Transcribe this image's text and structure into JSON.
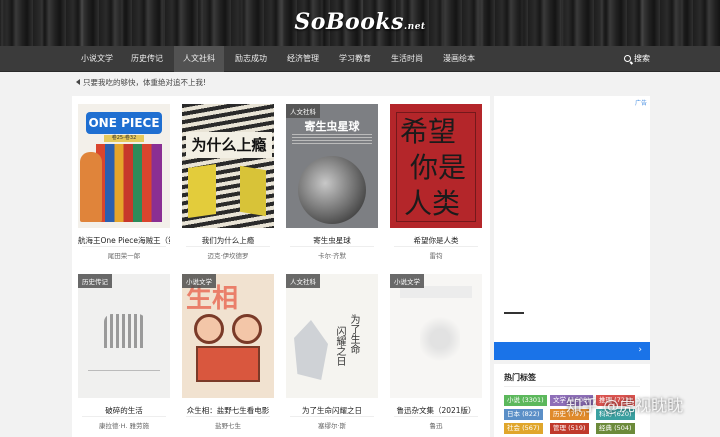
{
  "header": {
    "logo": "SoBooks",
    "logo_suffix": ".net"
  },
  "nav": {
    "items": [
      {
        "label": "小说文学",
        "active": false
      },
      {
        "label": "历史传记",
        "active": false
      },
      {
        "label": "人文社科",
        "active": true
      },
      {
        "label": "励志成功",
        "active": false
      },
      {
        "label": "经济管理",
        "active": false
      },
      {
        "label": "学习教育",
        "active": false
      },
      {
        "label": "生活时尚",
        "active": false
      },
      {
        "label": "漫画绘本",
        "active": false
      }
    ],
    "search_label": "搜索"
  },
  "notice": "只要我吃的够快，体重绝对追不上我!",
  "books": [
    {
      "title": "航海王One Piece海贼王（第",
      "author": "尾田荣一郎",
      "badge": "",
      "cover_text": "ONE PIECE",
      "cover_sub": "卷25-卷32"
    },
    {
      "title": "我们为什么上瘾",
      "author": "迈克·伊坎德罗",
      "badge": "",
      "cover_text": "为什么上瘾"
    },
    {
      "title": "寄生虫星球",
      "author": "卡尔·齐默",
      "badge": "人文社科",
      "cover_text": "寄生虫星球"
    },
    {
      "title": "希望你是人类",
      "author": "雷钧",
      "badge": "",
      "cover_text": "希望你是人类"
    },
    {
      "title": "破碎的生活",
      "author": "康拉德·H. 雅劳施",
      "badge": "历史传记",
      "cover_text": ""
    },
    {
      "title": "众生相：盐野七生看电影",
      "author": "盐野七生",
      "badge": "小说文学",
      "cover_text": "生相"
    },
    {
      "title": "为了生命闪耀之日",
      "author": "塞缪尔·斯",
      "badge": "人文社科",
      "cover_text": "为了生命闪耀之日"
    },
    {
      "title": "鲁迅杂文集（2021版）",
      "author": "鲁迅",
      "badge": "小说文学",
      "cover_text": ""
    }
  ],
  "sidebar": {
    "ad_label": "广告",
    "ad_arrow": "›",
    "tags_title": "热门标签",
    "tags": [
      {
        "label": "小说 (3301)",
        "color": "#5cb85c"
      },
      {
        "label": "文学 (1600)",
        "color": "#8e6fb8"
      },
      {
        "label": "推理 (721)",
        "color": "#d9534f"
      },
      {
        "label": "日本 (822)",
        "color": "#5b8fc7"
      },
      {
        "label": "历史 (797)",
        "color": "#e08a2b"
      },
      {
        "label": "科幻 (620)",
        "color": "#3aa0a0"
      },
      {
        "label": "社会 (567)",
        "color": "#e0a62b"
      },
      {
        "label": "管理 (519)",
        "color": "#c0392b"
      },
      {
        "label": "经典 (504)",
        "color": "#6c8a3a"
      }
    ]
  },
  "watermark": "知乎 @虎视眈眈"
}
